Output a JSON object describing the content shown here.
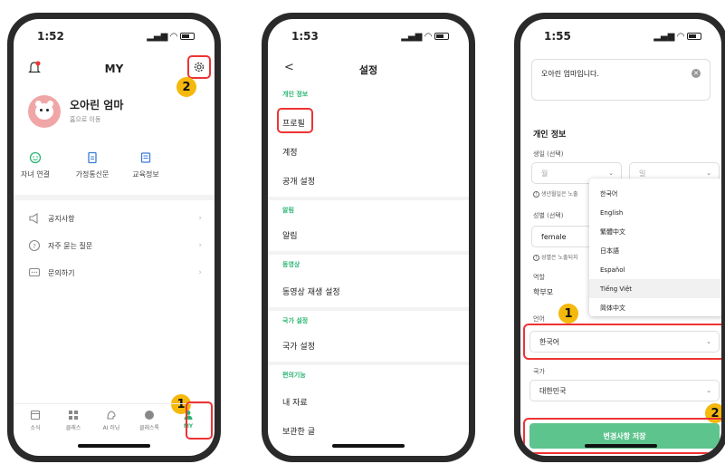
{
  "phone1": {
    "time": "1:52",
    "title": "MY",
    "profile_name": "오아린 엄마",
    "profile_sub": "홈으로 이동",
    "quick": [
      {
        "label": "자녀 연결",
        "icon": "child-link-icon"
      },
      {
        "label": "가정통신문",
        "icon": "document-icon"
      },
      {
        "label": "교육정보",
        "icon": "book-icon"
      }
    ],
    "menu": [
      {
        "label": "공지사항",
        "icon": "megaphone-icon"
      },
      {
        "label": "자주 묻는 질문",
        "icon": "question-icon"
      },
      {
        "label": "문의하기",
        "icon": "chat-icon"
      }
    ],
    "tabs": [
      {
        "label": "소식",
        "icon": "news-icon"
      },
      {
        "label": "클래스",
        "icon": "grid-icon"
      },
      {
        "label": "AI 러닝",
        "icon": "ai-icon"
      },
      {
        "label": "클래스톡",
        "icon": "talk-icon"
      },
      {
        "label": "MY",
        "icon": "person-icon"
      }
    ],
    "badge_tab": "1",
    "badge_gear": "2"
  },
  "phone2": {
    "time": "1:53",
    "back": "<",
    "title": "설정",
    "sections": [
      {
        "head": "개인 정보",
        "rows": [
          "프로필",
          "계정",
          "공개 설정"
        ]
      },
      {
        "head": "알림",
        "rows": [
          "알림"
        ]
      },
      {
        "head": "동영상",
        "rows": [
          "동영상 재생 설정"
        ]
      },
      {
        "head": "국가 설정",
        "rows": [
          "국가 설정"
        ]
      },
      {
        "head": "편의기능",
        "rows": [
          "내 자료",
          "보관한 글"
        ]
      }
    ]
  },
  "phone3": {
    "time": "1:55",
    "intro": "오아린 엄마입니다.",
    "section": "개인 정보",
    "birth_label": "생일 (선택)",
    "month_placeholder": "월",
    "day_placeholder": "일",
    "birth_hint": "생년월일은 노출",
    "gender_label": "성별 (선택)",
    "gender_value": "female",
    "gender_hint": "성별은 노출되지",
    "role_label": "역할",
    "role_value": "학부모",
    "lang_label": "언어",
    "lang_value": "한국어",
    "country_label": "국가",
    "country_value": "대한민국",
    "save_label": "변경사항 저장",
    "options": [
      "한국어",
      "English",
      "繁體中文",
      "日本語",
      "Español",
      "Tiếng Việt",
      "简体中文"
    ],
    "highlighted_option": "Tiếng Việt",
    "badge_lang": "1",
    "badge_save": "2"
  },
  "colors": {
    "accent": "#2bb673",
    "highlight": "#e33333",
    "badge": "#f5b80c",
    "button": "#5ec48e"
  }
}
